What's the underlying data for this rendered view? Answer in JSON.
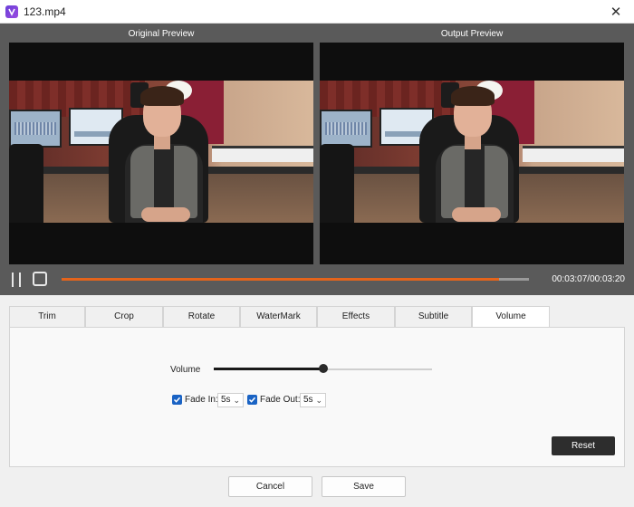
{
  "window": {
    "title": "123.mp4",
    "close_glyph": "✕",
    "app_icon": "video-editor-logo"
  },
  "preview": {
    "original_label": "Original Preview",
    "output_label": "Output Preview",
    "progress_fraction": 0.936,
    "time_readout": "00:03:07/00:03:20"
  },
  "tabs": [
    {
      "label": "Trim"
    },
    {
      "label": "Crop"
    },
    {
      "label": "Rotate"
    },
    {
      "label": "WaterMark"
    },
    {
      "label": "Effects"
    },
    {
      "label": "Subtitle"
    },
    {
      "label": "Volume",
      "active": true
    }
  ],
  "volume": {
    "label": "Volume",
    "level_fraction": 0.5,
    "fade_in": {
      "label": "Fade In:",
      "checked": true,
      "value": "5s"
    },
    "fade_out": {
      "label": "Fade Out:",
      "checked": true,
      "value": "5s"
    },
    "reset_label": "Reset"
  },
  "footer": {
    "cancel_label": "Cancel",
    "save_label": "Save"
  },
  "colors": {
    "accent_progress": "#e4641c",
    "checkbox": "#1a63c4",
    "reset_button": "#2d2d2d"
  }
}
